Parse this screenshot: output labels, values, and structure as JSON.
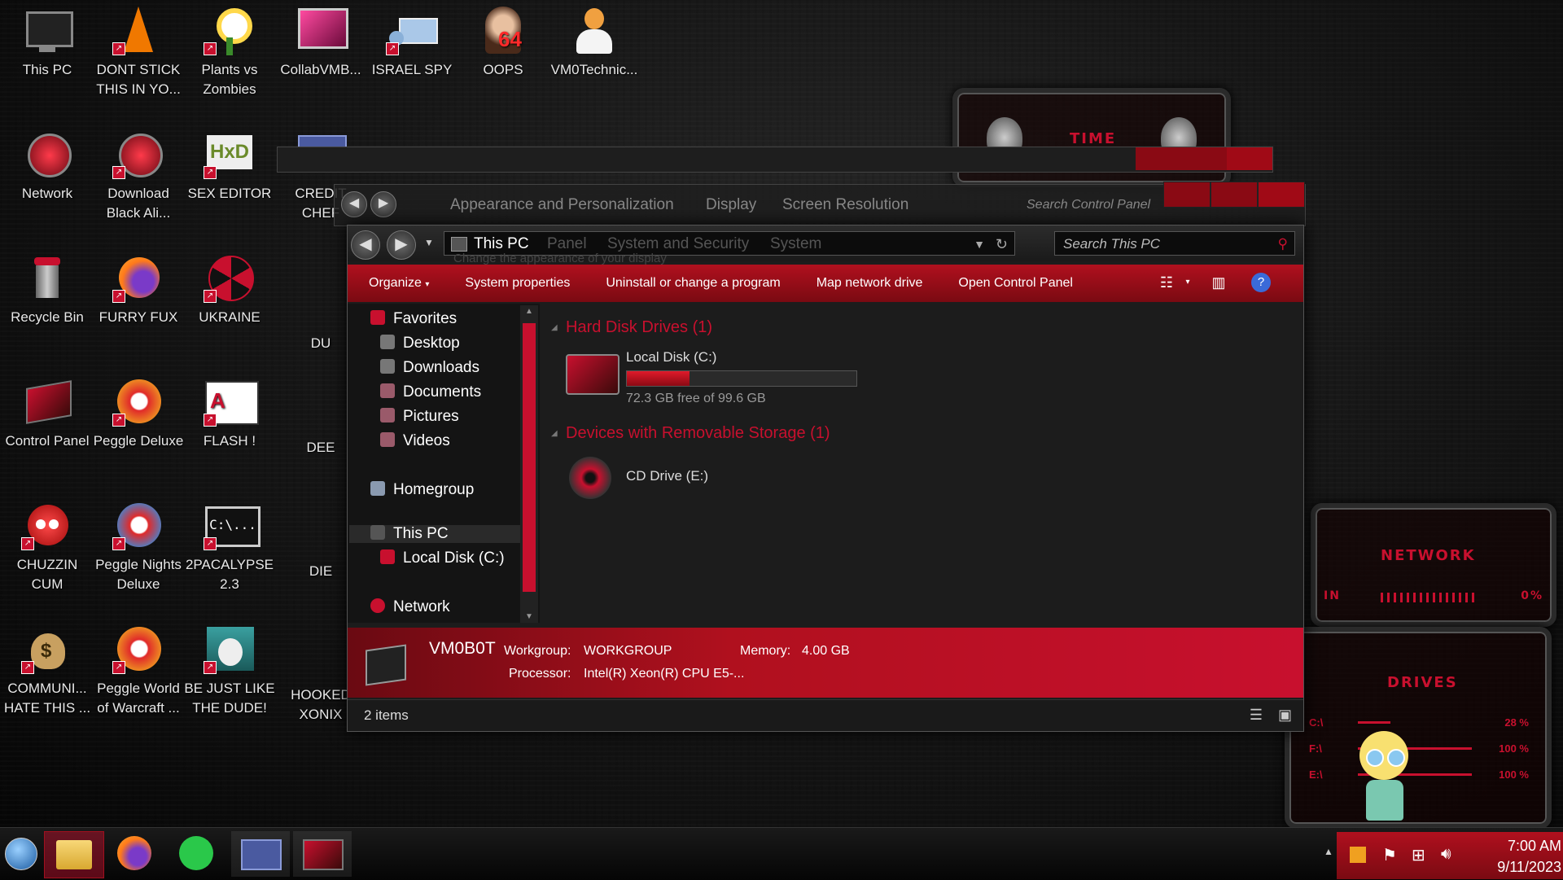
{
  "desktop_icons": [
    {
      "label": "This PC"
    },
    {
      "label": "DONT STICK THIS IN YO..."
    },
    {
      "label": "Plants vs Zombies"
    },
    {
      "label": "CollabVMB..."
    },
    {
      "label": "ISRAEL SPY"
    },
    {
      "label": "OOPS",
      "badge": "64"
    },
    {
      "label": "VM0Technic..."
    },
    {
      "label": "Network"
    },
    {
      "label": "Download Black Ali..."
    },
    {
      "label": "SEX EDITOR",
      "icon_text": "HxD"
    },
    {
      "label": "CREDIT CHEF"
    },
    {
      "label": "Recycle Bin"
    },
    {
      "label": "FURRY FUX"
    },
    {
      "label": "UKRAINE"
    },
    {
      "label": "DU"
    },
    {
      "label": "Control Panel"
    },
    {
      "label": "Peggle Deluxe"
    },
    {
      "label": "FLASH !"
    },
    {
      "label": "DEE"
    },
    {
      "label": "CHUZZIN CUM"
    },
    {
      "label": "Peggle Nights Deluxe"
    },
    {
      "label": "2PACALYPSE 2.3",
      "icon_text": "C:\\..."
    },
    {
      "label": "DIE"
    },
    {
      "label": "COMMUNI... HATE THIS ..."
    },
    {
      "label": "Peggle World of Warcraft ..."
    },
    {
      "label": "BE JUST LIKE THE DUDE!"
    },
    {
      "label": "HOOKED XONIX"
    }
  ],
  "widgets": {
    "time": "TIME",
    "network": "NETWORK",
    "network_in": "IN",
    "network_pct": "0%",
    "drives": "DRIVES",
    "drive_rows": [
      {
        "label": "C:\\",
        "pct": "28 %"
      },
      {
        "label": "F:\\",
        "pct": "100 %"
      },
      {
        "label": "E:\\",
        "pct": "100 %"
      }
    ]
  },
  "back_window": {
    "crumbs": [
      "Appearance and Personalization",
      "Display",
      "Screen Resolution"
    ],
    "search_placeholder": "Search Control Panel",
    "crumbs2": [
      "Panel",
      "System and Security",
      "System"
    ],
    "subtitle": "Change the appearance of your display"
  },
  "explorer": {
    "address": "This PC",
    "search_placeholder": "Search This PC",
    "commands": [
      "Organize",
      "System properties",
      "Uninstall or change a program",
      "Map network drive",
      "Open Control Panel"
    ],
    "nav": {
      "favorites": "Favorites",
      "desktop": "Desktop",
      "downloads": "Downloads",
      "documents": "Documents",
      "pictures": "Pictures",
      "videos": "Videos",
      "homegroup": "Homegroup",
      "this_pc": "This PC",
      "local_disk": "Local Disk (C:)",
      "network": "Network"
    },
    "groups": {
      "hdd": "Hard Disk Drives (1)",
      "removable": "Devices with Removable Storage (1)"
    },
    "drive_c": {
      "name": "Local Disk (C:)",
      "free": "72.3 GB free of 99.6 GB",
      "used_fraction": 0.274
    },
    "drive_e": {
      "name": "CD Drive (E:)"
    },
    "details": {
      "computer": "VM0B0T",
      "workgroup_label": "Workgroup:",
      "workgroup": "WORKGROUP",
      "memory_label": "Memory:",
      "memory": "4.00 GB",
      "processor_label": "Processor:",
      "processor": "Intel(R) Xeon(R) CPU E5-..."
    },
    "status": "2 items"
  },
  "tray": {
    "time": "7:00 AM",
    "date": "9/11/2023"
  },
  "colors": {
    "accent": "#c8102e",
    "dark": "#1c1c1c"
  }
}
